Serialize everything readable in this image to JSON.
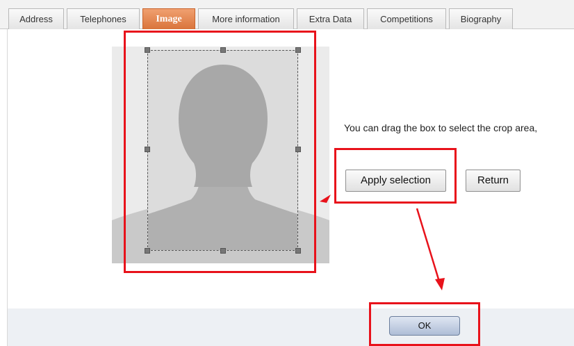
{
  "tabs": [
    {
      "label": "Address"
    },
    {
      "label": "Telephones"
    },
    {
      "label": "Image",
      "active": true
    },
    {
      "label": "More information"
    },
    {
      "label": "Extra Data"
    },
    {
      "label": "Competitions"
    },
    {
      "label": "Biography"
    }
  ],
  "crop": {
    "hint_text": "You can drag the box to select the crop area,"
  },
  "buttons": {
    "apply": "Apply selection",
    "return": "Return",
    "ok": "OK"
  },
  "colors": {
    "active_tab": "#d9743b",
    "annotation": "#e8121b"
  }
}
